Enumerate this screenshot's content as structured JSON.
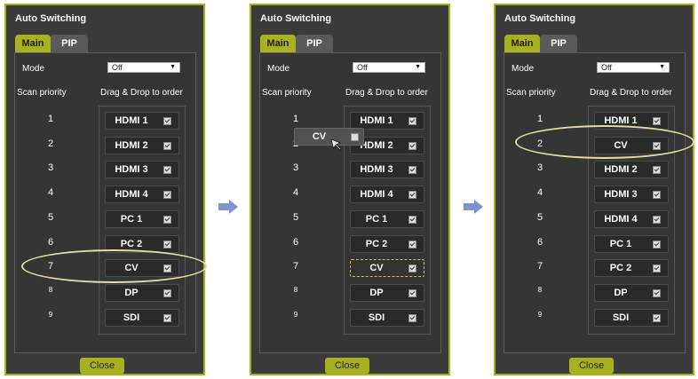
{
  "panels": [
    {
      "title": "Auto Switching",
      "tabs": {
        "main": "Main",
        "pip": "PIP"
      },
      "mode_label": "Mode",
      "mode_value": "Off",
      "scan_header": "Scan priority",
      "order_header": "Drag & Drop to order",
      "numbers": [
        "1",
        "2",
        "3",
        "4",
        "5",
        "6",
        "7",
        "8",
        "9"
      ],
      "sources": [
        "HDMI 1",
        "HDMI 2",
        "HDMI 3",
        "HDMI 4",
        "PC 1",
        "PC 2",
        "CV",
        "DP",
        "SDI"
      ],
      "close_label": "Close"
    },
    {
      "title": "Auto Switching",
      "tabs": {
        "main": "Main",
        "pip": "PIP"
      },
      "mode_label": "Mode",
      "mode_value": "Off",
      "scan_header": "Scan priority",
      "order_header": "Drag & Drop to order",
      "numbers": [
        "1",
        "2",
        "3",
        "4",
        "5",
        "6",
        "7",
        "8",
        "9"
      ],
      "sources": [
        "HDMI 1",
        "HDMI 2",
        "HDMI 3",
        "HDMI 4",
        "PC 1",
        "PC 2",
        "CV",
        "DP",
        "SDI"
      ],
      "dragging_label": "CV",
      "close_label": "Close"
    },
    {
      "title": "Auto Switching",
      "tabs": {
        "main": "Main",
        "pip": "PIP"
      },
      "mode_label": "Mode",
      "mode_value": "Off",
      "scan_header": "Scan priority",
      "order_header": "Drag & Drop to order",
      "numbers": [
        "1",
        "2",
        "3",
        "4",
        "5",
        "6",
        "7",
        "8",
        "9"
      ],
      "sources": [
        "HDMI 1",
        "CV",
        "HDMI 2",
        "HDMI 3",
        "HDMI 4",
        "PC 1",
        "PC 2",
        "DP",
        "SDI"
      ],
      "close_label": "Close"
    }
  ],
  "colors": {
    "accent": "#a9b21e",
    "panel_bg": "#3b3b3b",
    "highlight": "#e5dca0",
    "arrow": "#7b96cc"
  },
  "icons": {
    "arrow": "right-arrow-icon",
    "cursor": "mouse-pointer-icon",
    "checkbox": "checkbox-checked-icon",
    "dropdown": "chevron-down-icon"
  }
}
